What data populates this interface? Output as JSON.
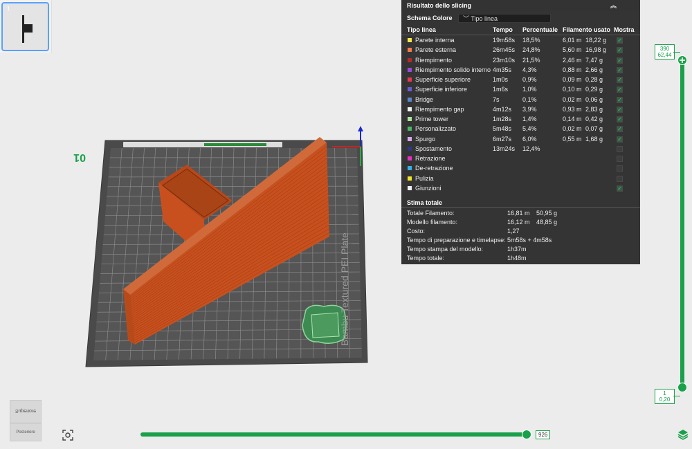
{
  "plate": {
    "number": "1"
  },
  "viewport": {
    "plate_number": "01",
    "plate_label": "Bambu Textured PEI Plate"
  },
  "panel": {
    "title": "Risultato dello slicing",
    "schema_label": "Schema Colore",
    "schema_value": "Tipo linea",
    "columns": [
      "Tipo linea",
      "Tempo",
      "Percentuale",
      "Filamento usato",
      "Mostra"
    ],
    "rows": [
      {
        "name": "Parete interna",
        "color": "#f5e64a",
        "time": "19m58s",
        "pct": "18,5%",
        "len": "6,01 m",
        "weight": "18,22 g",
        "show": true
      },
      {
        "name": "Parete esterna",
        "color": "#f5794a",
        "time": "26m45s",
        "pct": "24,8%",
        "len": "5,60 m",
        "weight": "16,98 g",
        "show": true
      },
      {
        "name": "Riempimento",
        "color": "#b42a2a",
        "time": "23m10s",
        "pct": "21,5%",
        "len": "2,46 m",
        "weight": "7,47 g",
        "show": true
      },
      {
        "name": "Riempimento solido interno",
        "color": "#9a4ad6",
        "time": "4m35s",
        "pct": "4,3%",
        "len": "0,88 m",
        "weight": "2,66 g",
        "show": true
      },
      {
        "name": "Superficie superiore",
        "color": "#e8394a",
        "time": "1m0s",
        "pct": "0,9%",
        "len": "0,09 m",
        "weight": "0,28 g",
        "show": true
      },
      {
        "name": "Superficie inferiore",
        "color": "#6a5ad6",
        "time": "1m6s",
        "pct": "1,0%",
        "len": "0,10 m",
        "weight": "0,29 g",
        "show": true
      },
      {
        "name": "Bridge",
        "color": "#5a88c8",
        "time": "7s",
        "pct": "0,1%",
        "len": "0,02 m",
        "weight": "0,06 g",
        "show": true
      },
      {
        "name": "Riempimento gap",
        "color": "#f2f2f2",
        "time": "4m12s",
        "pct": "3,9%",
        "len": "0,93 m",
        "weight": "2,83 g",
        "show": true
      },
      {
        "name": "Prime tower",
        "color": "#a8e6a0",
        "time": "1m28s",
        "pct": "1,4%",
        "len": "0,14 m",
        "weight": "0,42 g",
        "show": true
      },
      {
        "name": "Personalizzato",
        "color": "#4ab86a",
        "time": "5m48s",
        "pct": "5,4%",
        "len": "0,02 m",
        "weight": "0,07 g",
        "show": true
      },
      {
        "name": "Spurgo",
        "color": "#d6a8f0",
        "time": "6m27s",
        "pct": "6,0%",
        "len": "0,55 m",
        "weight": "1,68 g",
        "show": true
      },
      {
        "name": "Spostamento",
        "color": "#2a3a8a",
        "time": "13m24s",
        "pct": "12,4%",
        "len": "",
        "weight": "",
        "show": false
      },
      {
        "name": "Retrazione",
        "color": "#e830c8",
        "time": "",
        "pct": "",
        "len": "",
        "weight": "",
        "show": false
      },
      {
        "name": "De-retrazione",
        "color": "#38b0e8",
        "time": "",
        "pct": "",
        "len": "",
        "weight": "",
        "show": false
      },
      {
        "name": "Pulizia",
        "color": "#f2e62a",
        "time": "",
        "pct": "",
        "len": "",
        "weight": "",
        "show": false
      },
      {
        "name": "Giunzioni",
        "color": "#f0f0f0",
        "time": "",
        "pct": "",
        "len": "",
        "weight": "",
        "show": true
      }
    ],
    "totals_title": "Stima totale",
    "totals": [
      {
        "label": "Totale Filamento:",
        "v1": "16,81 m",
        "v2": "50,95 g"
      },
      {
        "label": "Modello filamento:",
        "v1": "16,12 m",
        "v2": "48,85 g"
      },
      {
        "label": "Costo:",
        "v1": "1,27",
        "v2": ""
      },
      {
        "label": "Tempo di preparazione e timelapse:",
        "v1": "5m58s + 4m58s",
        "v2": ""
      },
      {
        "label": "Tempo stampa del modello:",
        "v1": "1h37m",
        "v2": ""
      },
      {
        "label": "Tempo totale:",
        "v1": "1h48m",
        "v2": ""
      }
    ]
  },
  "layer_slider": {
    "top_layer": "390",
    "top_height": "62,44",
    "bottom_layer": "1",
    "bottom_height": "0,20"
  },
  "move_slider": {
    "value": "926"
  },
  "navcube": {
    "top_face": "Superiore",
    "front_face": "Posteriore"
  },
  "colors": {
    "accent": "#1aa04a",
    "part": "#c8501e",
    "panel_bg": "#2c2c2c"
  }
}
